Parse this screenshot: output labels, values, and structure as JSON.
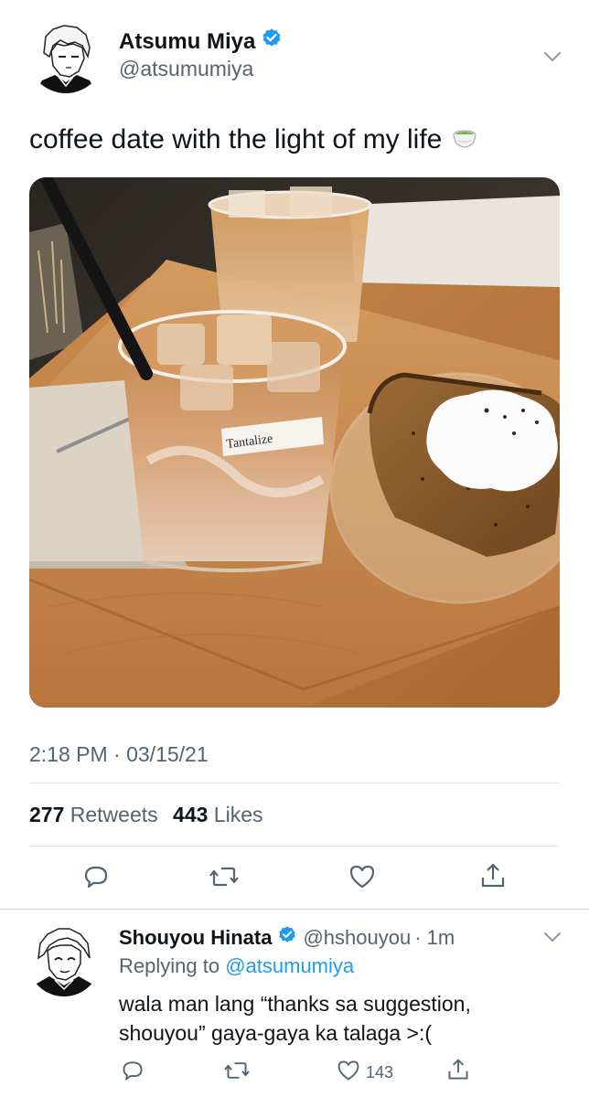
{
  "tweet": {
    "author": {
      "name": "Atsumu Miya",
      "handle": "@atsumumiya",
      "verified": true
    },
    "text": "coffee date with the light of my life",
    "emoji": "teacup-without-handle",
    "timestamp": "2:18 PM · 03/15/21",
    "stats": {
      "retweets": "277",
      "retweets_label": "Retweets",
      "likes": "443",
      "likes_label": "Likes"
    },
    "actions": [
      "reply-icon",
      "retweet-icon",
      "like-icon",
      "share-icon"
    ]
  },
  "photo": {
    "cup_label": "Tantalize"
  },
  "reply": {
    "author": {
      "name": "Shouyou Hinata",
      "handle": "@hshouyou",
      "time": "· 1m",
      "verified": true
    },
    "replying_prefix": "Replying to",
    "replying_to": "@atsumumiya",
    "text": "wala man lang “thanks sa suggestion, shouyou” gaya-gaya ka talaga >:(",
    "like_count": "143"
  },
  "colors": {
    "accent": "#1d9bf0",
    "text": "#0f1419",
    "muted": "#536471"
  }
}
